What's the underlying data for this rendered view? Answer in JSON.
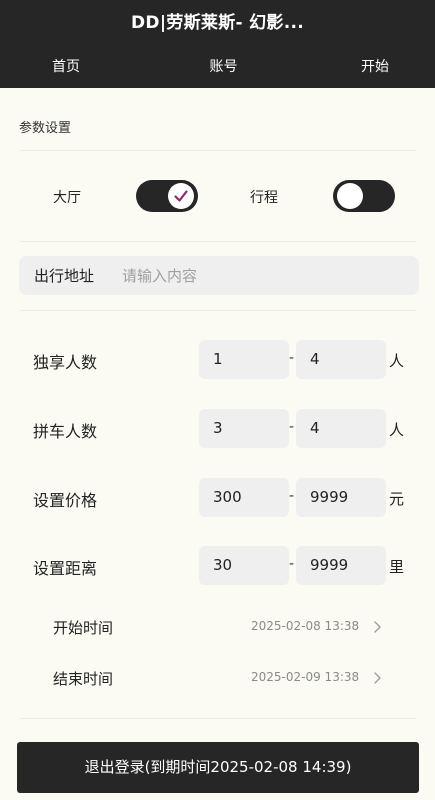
{
  "header": {
    "title": "DD|劳斯莱斯- 幻影...",
    "tabs": [
      "首页",
      "账号",
      "开始"
    ]
  },
  "params": {
    "section_title": "参数设置",
    "hall_label": "大厅",
    "hall_on": true,
    "trip_label": "行程",
    "trip_on": false
  },
  "address": {
    "label": "出行地址",
    "placeholder": "请输入内容",
    "value": ""
  },
  "ranges": [
    {
      "label": "独享人数",
      "min": "1",
      "max": "4",
      "unit": "人"
    },
    {
      "label": "拼车人数",
      "min": "3",
      "max": "4",
      "unit": "人"
    },
    {
      "label": "设置价格",
      "min": "300",
      "max": "9999",
      "unit": "元"
    },
    {
      "label": "设置距离",
      "min": "30",
      "max": "9999",
      "unit": "里"
    }
  ],
  "dash": "-",
  "times": {
    "start_label": "开始时间",
    "start_value": "2025-02-08 13:38",
    "end_label": "结束时间",
    "end_value": "2025-02-09 13:38"
  },
  "logout_label": "退出登录(到期时间2025-02-08 14:39)",
  "colors": {
    "dark": "#262626",
    "background": "#fbfbf4",
    "field": "#efefef",
    "check_accent": "#8e2a6e"
  },
  "icons": [
    "check-icon",
    "chevron-right-icon"
  ]
}
